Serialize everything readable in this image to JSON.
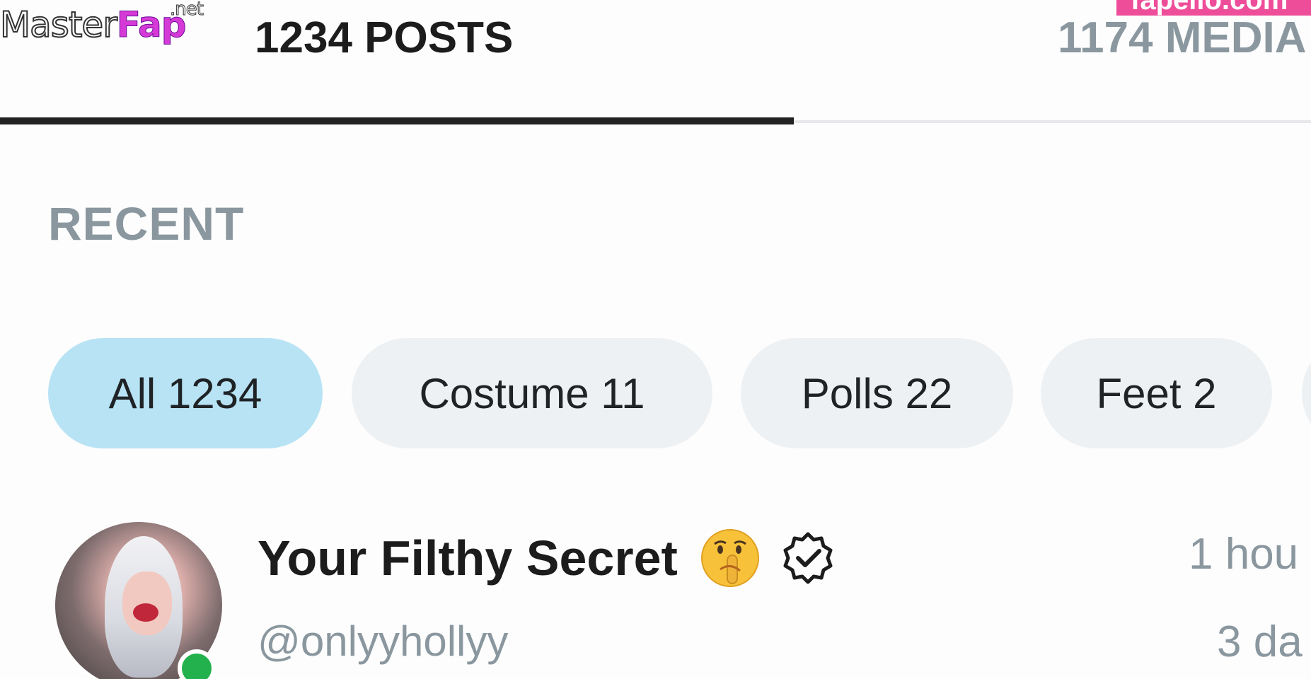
{
  "watermarks": {
    "logo_master": "Master",
    "logo_fap": "Fap",
    "logo_net": ".net",
    "right_text": "fapello.com"
  },
  "tabs": [
    {
      "label": "1234 POSTS",
      "active": true
    },
    {
      "label": "1174 MEDIA",
      "active": false
    }
  ],
  "section": {
    "title": "RECENT"
  },
  "filters": [
    {
      "label": "All 1234",
      "active": true
    },
    {
      "label": "Costume 11",
      "active": false
    },
    {
      "label": "Polls 22",
      "active": false
    },
    {
      "label": "Feet 2",
      "active": false
    }
  ],
  "post": {
    "author_name": "Your Filthy Secret",
    "author_emoji": "shushing-face-emoji",
    "verified_icon": "verified-badge-icon",
    "handle": "@onlyyhollyy",
    "time": "1 hou",
    "age": "3 da",
    "online": true
  },
  "colors": {
    "active_chip": "#b8e3f5",
    "chip": "#eef1f3",
    "muted_text": "#8a979f",
    "dark_text": "#1c1c1c",
    "online": "#22b14c",
    "tab_underline": "#222222",
    "watermark_pink": "#ee4d9a"
  }
}
